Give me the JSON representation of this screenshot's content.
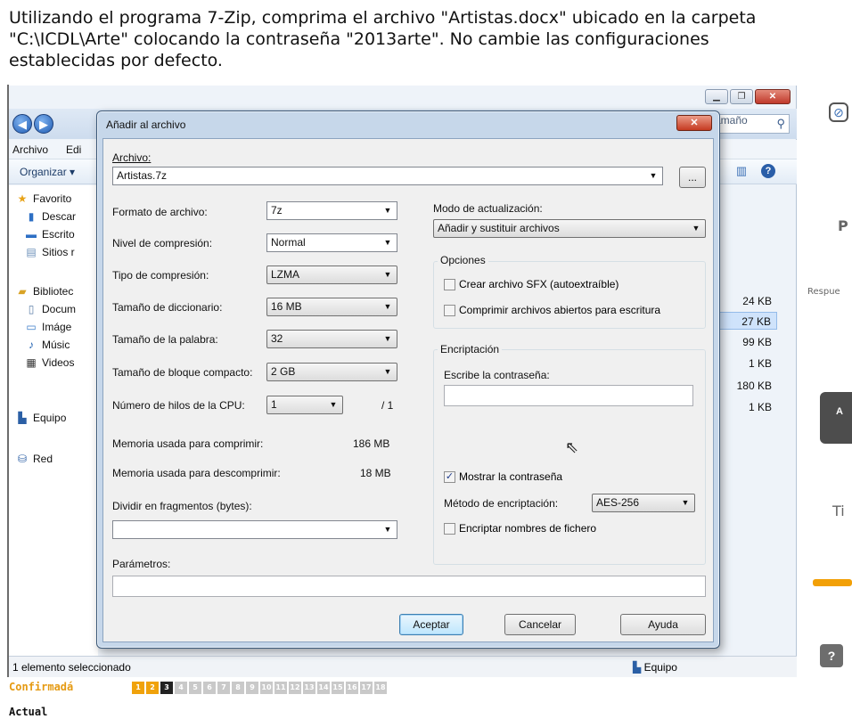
{
  "question": {
    "text": "Utilizando el programa 7-Zip, comprima el archivo \"Artistas.docx\" ubicado en la carpeta \"C:\\ICDL\\Arte\" colocando la contraseña \"2013arte\". No cambie las configuraciones establecidas por defecto."
  },
  "explorer": {
    "menu": [
      "Archivo",
      "Edi"
    ],
    "organize_label": "Organizar ▾",
    "nav_items": [
      "Favorito",
      "Descar",
      "Escrito",
      "Sitios r",
      "Bibliotec",
      "Docum",
      "Imáge",
      "Músic",
      "Videos",
      "Equipo",
      "Red"
    ],
    "column_header": "Tamaño",
    "sizes": [
      "24 KB",
      "27 KB",
      "99 KB",
      "1 KB",
      "180 KB",
      "1 KB"
    ],
    "status_left": "1 elemento seleccionado",
    "status_right": "Equipo"
  },
  "dialog": {
    "title": "Añadir al archivo",
    "archive_label": "Archivo:",
    "archive_value": "Artistas.7z",
    "browse_label": "...",
    "left": {
      "format_label": "Formato de archivo:",
      "format_value": "7z",
      "level_label": "Nivel de compresión:",
      "level_value": "Normal",
      "type_label": "Tipo de compresión:",
      "type_value": "LZMA",
      "dict_label": "Tamaño de diccionario:",
      "dict_value": "16 MB",
      "word_label": "Tamaño de la palabra:",
      "word_value": "32",
      "solid_label": "Tamaño de bloque compacto:",
      "solid_value": "2 GB",
      "threads_label": "Número de hilos de la CPU:",
      "threads_value": "1",
      "threads_max": "/ 1",
      "mem_comp_label": "Memoria usada para comprimir:",
      "mem_comp_value": "186 MB",
      "mem_decomp_label": "Memoria usada para descomprimir:",
      "mem_decomp_value": "18 MB",
      "split_label": "Dividir en fragmentos (bytes):",
      "split_value": ""
    },
    "right": {
      "update_label": "Modo de actualización:",
      "update_value": "Añadir y sustituir archivos",
      "options_title": "Opciones",
      "sfx_label": "Crear archivo SFX (autoextraíble)",
      "shared_label": "Comprimir archivos abiertos para escritura",
      "encryption_title": "Encriptación",
      "password_label": "Escribe la contraseña:",
      "password_value": "",
      "show_password_label": "Mostrar la contraseña",
      "show_password_checked": true,
      "method_label": "Método de encriptación:",
      "method_value": "AES-256",
      "encrypt_names_label": "Encriptar nombres de fichero"
    },
    "params_label": "Parámetros:",
    "params_value": "",
    "buttons": {
      "ok": "Aceptar",
      "cancel": "Cancelar",
      "help": "Ayuda"
    }
  },
  "right_panel": {
    "p_letter": "P",
    "respue": "Respue",
    "a_letter": "A",
    "ti": "Ti",
    "help": "?"
  },
  "bottom": {
    "confirm": "Confirmadá",
    "actual": "Actual",
    "pages": [
      "1",
      "2",
      "3",
      "4",
      "5",
      "6",
      "7",
      "8",
      "9",
      "10",
      "11",
      "12",
      "13",
      "14",
      "15",
      "16",
      "17",
      "18"
    ],
    "done_pages": 2,
    "current_page": 3
  },
  "colors": {
    "accent_orange": "#f0a20b",
    "dialog_frame": "#c6d7ea"
  }
}
